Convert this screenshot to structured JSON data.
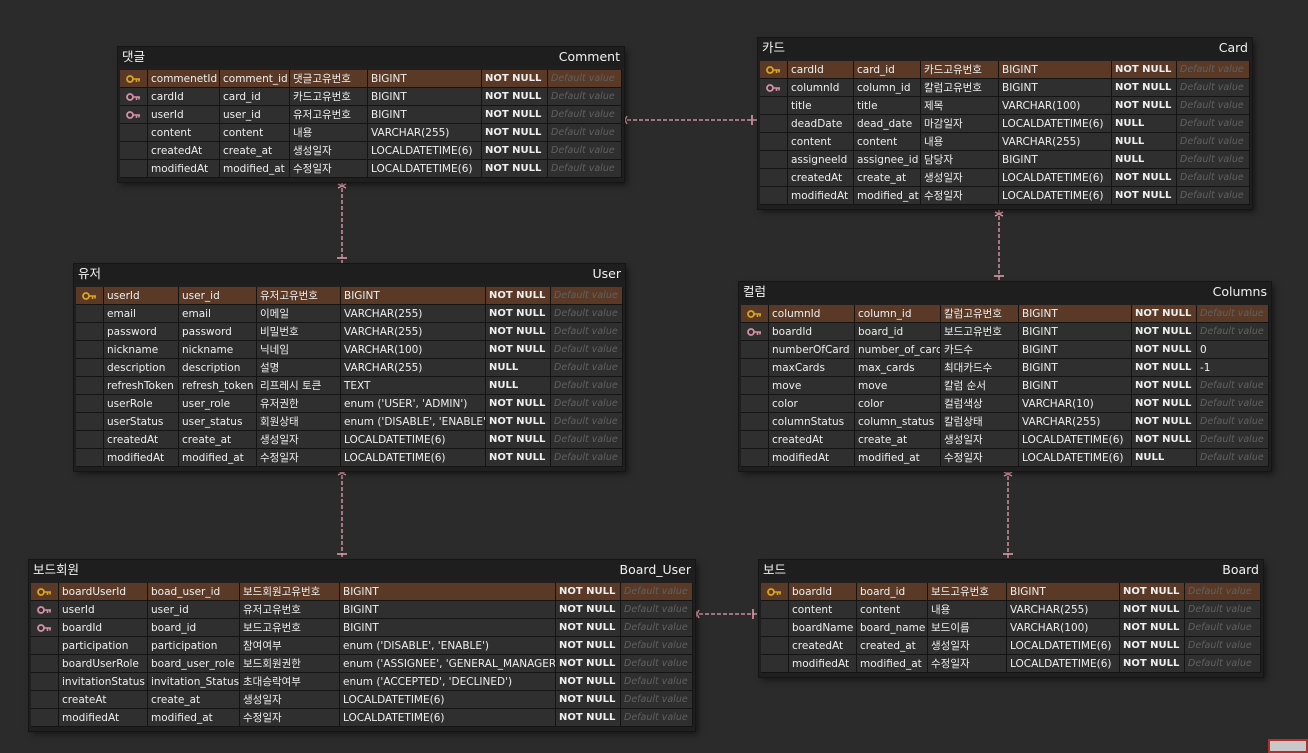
{
  "colors": {
    "background": "#2b2b2b",
    "table_bg": "#1f1f1f",
    "row_bg": "#2f2f2f",
    "pk_row_bg": "#5a3a26",
    "relationship_line": "#e8a0b0",
    "pk_key_icon": "#d9a520",
    "fk_key_icon": "#d58fa8"
  },
  "entities": [
    {
      "id": "comment",
      "kr_name": "댓글",
      "en_name": "Comment",
      "rows": [
        {
          "key": "pk",
          "name": "commenetId",
          "column": "comment_id",
          "desc": "댓글고유번호",
          "type": "BIGINT",
          "nullable": "NOT NULL",
          "default": "Default value"
        },
        {
          "key": "fk",
          "name": "cardId",
          "column": "card_id",
          "desc": "카드고유번호",
          "type": "BIGINT",
          "nullable": "NOT NULL",
          "default": "Default value"
        },
        {
          "key": "fk",
          "name": "userId",
          "column": "user_id",
          "desc": "유저고유번호",
          "type": "BIGINT",
          "nullable": "NOT NULL",
          "default": "Default value"
        },
        {
          "key": "",
          "name": "content",
          "column": "content",
          "desc": "내용",
          "type": "VARCHAR(255)",
          "nullable": "NOT NULL",
          "default": "Default value"
        },
        {
          "key": "",
          "name": "createdAt",
          "column": "create_at",
          "desc": "생성일자",
          "type": "LOCALDATETIME(6)",
          "nullable": "NOT NULL",
          "default": "Default value"
        },
        {
          "key": "",
          "name": "modifiedAt",
          "column": "modified_at",
          "desc": "수정일자",
          "type": "LOCALDATETIME(6)",
          "nullable": "NOT NULL",
          "default": "Default value"
        }
      ]
    },
    {
      "id": "card",
      "kr_name": "카드",
      "en_name": "Card",
      "rows": [
        {
          "key": "pk",
          "name": "cardId",
          "column": "card_id",
          "desc": "카드고유번호",
          "type": "BIGINT",
          "nullable": "NOT NULL",
          "default": "Default value"
        },
        {
          "key": "fk",
          "name": "columnId",
          "column": "column_id",
          "desc": "칼럼고유번호",
          "type": "BIGINT",
          "nullable": "NOT NULL",
          "default": "Default value"
        },
        {
          "key": "",
          "name": "title",
          "column": "title",
          "desc": "제목",
          "type": "VARCHAR(100)",
          "nullable": "NOT NULL",
          "default": "Default value"
        },
        {
          "key": "",
          "name": "deadDate",
          "column": "dead_date",
          "desc": "마감일자",
          "type": "LOCALDATETIME(6)",
          "nullable": "NULL",
          "default": "Default value"
        },
        {
          "key": "",
          "name": "content",
          "column": "content",
          "desc": "내용",
          "type": "VARCHAR(255)",
          "nullable": "NULL",
          "default": "Default value"
        },
        {
          "key": "",
          "name": "assigneeId",
          "column": "assignee_id",
          "desc": "담당자",
          "type": "BIGINT",
          "nullable": "NULL",
          "default": "Default value"
        },
        {
          "key": "",
          "name": "createdAt",
          "column": "create_at",
          "desc": "생성일자",
          "type": "LOCALDATETIME(6)",
          "nullable": "NOT NULL",
          "default": "Default value"
        },
        {
          "key": "",
          "name": "modifiedAt",
          "column": "modified_at",
          "desc": "수정일자",
          "type": "LOCALDATETIME(6)",
          "nullable": "NOT NULL",
          "default": "Default value"
        }
      ]
    },
    {
      "id": "user",
      "kr_name": "유저",
      "en_name": "User",
      "rows": [
        {
          "key": "pk",
          "name": "userId",
          "column": "user_id",
          "desc": "유저고유번호",
          "type": "BIGINT",
          "nullable": "NOT NULL",
          "default": "Default value"
        },
        {
          "key": "",
          "name": "email",
          "column": "email",
          "desc": "이메일",
          "type": "VARCHAR(255)",
          "nullable": "NOT NULL",
          "default": "Default value"
        },
        {
          "key": "",
          "name": "password",
          "column": "password",
          "desc": "비밀번호",
          "type": "VARCHAR(255)",
          "nullable": "NOT NULL",
          "default": "Default value"
        },
        {
          "key": "",
          "name": "nickname",
          "column": "nickname",
          "desc": "닉네임",
          "type": "VARCHAR(100)",
          "nullable": "NOT NULL",
          "default": "Default value"
        },
        {
          "key": "",
          "name": "description",
          "column": "description",
          "desc": "설명",
          "type": "VARCHAR(255)",
          "nullable": "NULL",
          "default": "Default value"
        },
        {
          "key": "",
          "name": "refreshToken",
          "column": "refresh_token",
          "desc": "리프레시 토큰",
          "type": "TEXT",
          "nullable": "NULL",
          "default": "Default value"
        },
        {
          "key": "",
          "name": "userRole",
          "column": "user_role",
          "desc": "유저권한",
          "type": "enum ('USER', 'ADMIN')",
          "nullable": "NOT NULL",
          "default": "Default value"
        },
        {
          "key": "",
          "name": "userStatus",
          "column": "user_status",
          "desc": "회원상태",
          "type": "enum ('DISABLE', 'ENABLE')",
          "nullable": "NOT NULL",
          "default": "Default value"
        },
        {
          "key": "",
          "name": "createdAt",
          "column": "create_at",
          "desc": "생성일자",
          "type": "LOCALDATETIME(6)",
          "nullable": "NOT NULL",
          "default": "Default value"
        },
        {
          "key": "",
          "name": "modifiedAt",
          "column": "modified_at",
          "desc": "수정일자",
          "type": "LOCALDATETIME(6)",
          "nullable": "NOT NULL",
          "default": "Default value"
        }
      ]
    },
    {
      "id": "columns",
      "kr_name": "컬럼",
      "en_name": "Columns",
      "rows": [
        {
          "key": "pk",
          "name": "columnId",
          "column": "column_id",
          "desc": "칼럼고유번호",
          "type": "BIGINT",
          "nullable": "NOT NULL",
          "default": "Default value"
        },
        {
          "key": "fk",
          "name": "boardId",
          "column": "board_id",
          "desc": "보드고유번호",
          "type": "BIGINT",
          "nullable": "NOT NULL",
          "default": "Default value"
        },
        {
          "key": "",
          "name": "numberOfCard",
          "column": "number_of_card",
          "desc": "카드수",
          "type": "BIGINT",
          "nullable": "NOT NULL",
          "default": "0"
        },
        {
          "key": "",
          "name": "maxCards",
          "column": "max_cards",
          "desc": "최대카드수",
          "type": "BIGINT",
          "nullable": "NOT NULL",
          "default": "-1"
        },
        {
          "key": "",
          "name": "move",
          "column": "move",
          "desc": "칼럼 순서",
          "type": "BIGINT",
          "nullable": "NOT NULL",
          "default": "Default value"
        },
        {
          "key": "",
          "name": "color",
          "column": "color",
          "desc": "컬럼색상",
          "type": "VARCHAR(10)",
          "nullable": "NOT NULL",
          "default": "Default value"
        },
        {
          "key": "",
          "name": "columnStatus",
          "column": "column_status",
          "desc": "칼럼상태",
          "type": "VARCHAR(255)",
          "nullable": "NOT NULL",
          "default": "Default value"
        },
        {
          "key": "",
          "name": "createdAt",
          "column": "create_at",
          "desc": "생성일자",
          "type": "LOCALDATETIME(6)",
          "nullable": "NOT NULL",
          "default": "Default value"
        },
        {
          "key": "",
          "name": "modifiedAt",
          "column": "modified_at",
          "desc": "수정일자",
          "type": "LOCALDATETIME(6)",
          "nullable": "NULL",
          "default": "Default value"
        }
      ]
    },
    {
      "id": "board_user",
      "kr_name": "보드회원",
      "en_name": "Board_User",
      "rows": [
        {
          "key": "pk",
          "name": "boardUserId",
          "column": "boad_user_id",
          "desc": "보드회원고유번호",
          "type": "BIGINT",
          "nullable": "NOT NULL",
          "default": "Default value"
        },
        {
          "key": "fk",
          "name": "userId",
          "column": "user_id",
          "desc": "유저고유번호",
          "type": "BIGINT",
          "nullable": "NOT NULL",
          "default": "Default value"
        },
        {
          "key": "fk",
          "name": "boardId",
          "column": "board_id",
          "desc": "보드고유번호",
          "type": "BIGINT",
          "nullable": "NOT NULL",
          "default": "Default value"
        },
        {
          "key": "",
          "name": "participation",
          "column": "participation",
          "desc": "참여여부",
          "type": "enum ('DISABLE', 'ENABLE')",
          "nullable": "NOT NULL",
          "default": "Default value"
        },
        {
          "key": "",
          "name": "boardUserRole",
          "column": "board_user_role",
          "desc": "보드회원권한",
          "type": "enum ('ASSIGNEE', 'GENERAL_MANAGER')",
          "nullable": "NOT NULL",
          "default": "Default value"
        },
        {
          "key": "",
          "name": "invitationStatus",
          "column": "invitation_Status",
          "desc": "초대승락여부",
          "type": "enum ('ACCEPTED', 'DECLINED')",
          "nullable": "NOT NULL",
          "default": "Default value"
        },
        {
          "key": "",
          "name": "createAt",
          "column": "create_at",
          "desc": "생성일자",
          "type": "LOCALDATETIME(6)",
          "nullable": "NOT NULL",
          "default": "Default value"
        },
        {
          "key": "",
          "name": "modifiedAt",
          "column": "modified_at",
          "desc": "수정일자",
          "type": "LOCALDATETIME(6)",
          "nullable": "NOT NULL",
          "default": "Default value"
        }
      ]
    },
    {
      "id": "board",
      "kr_name": "보드",
      "en_name": "Board",
      "rows": [
        {
          "key": "pk",
          "name": "boardId",
          "column": "board_id",
          "desc": "보드고유번호",
          "type": "BIGINT",
          "nullable": "NOT NULL",
          "default": "Default value"
        },
        {
          "key": "",
          "name": "content",
          "column": "content",
          "desc": "내용",
          "type": "VARCHAR(255)",
          "nullable": "NOT NULL",
          "default": "Default value"
        },
        {
          "key": "",
          "name": "boardName",
          "column": "board_name",
          "desc": "보드이름",
          "type": "VARCHAR(100)",
          "nullable": "NOT NULL",
          "default": "Default value"
        },
        {
          "key": "",
          "name": "createdAt",
          "column": "created_at",
          "desc": "생성일자",
          "type": "LOCALDATETIME(6)",
          "nullable": "NOT NULL",
          "default": "Default value"
        },
        {
          "key": "",
          "name": "modifiedAt",
          "column": "modified_at",
          "desc": "수정일자",
          "type": "LOCALDATETIME(6)",
          "nullable": "NOT NULL",
          "default": "Default value"
        }
      ]
    }
  ],
  "relationships": [
    {
      "from": "comment",
      "to": "card"
    },
    {
      "from": "comment",
      "to": "user"
    },
    {
      "from": "card",
      "to": "columns"
    },
    {
      "from": "user",
      "to": "board_user"
    },
    {
      "from": "columns",
      "to": "board"
    },
    {
      "from": "board_user",
      "to": "board"
    }
  ]
}
